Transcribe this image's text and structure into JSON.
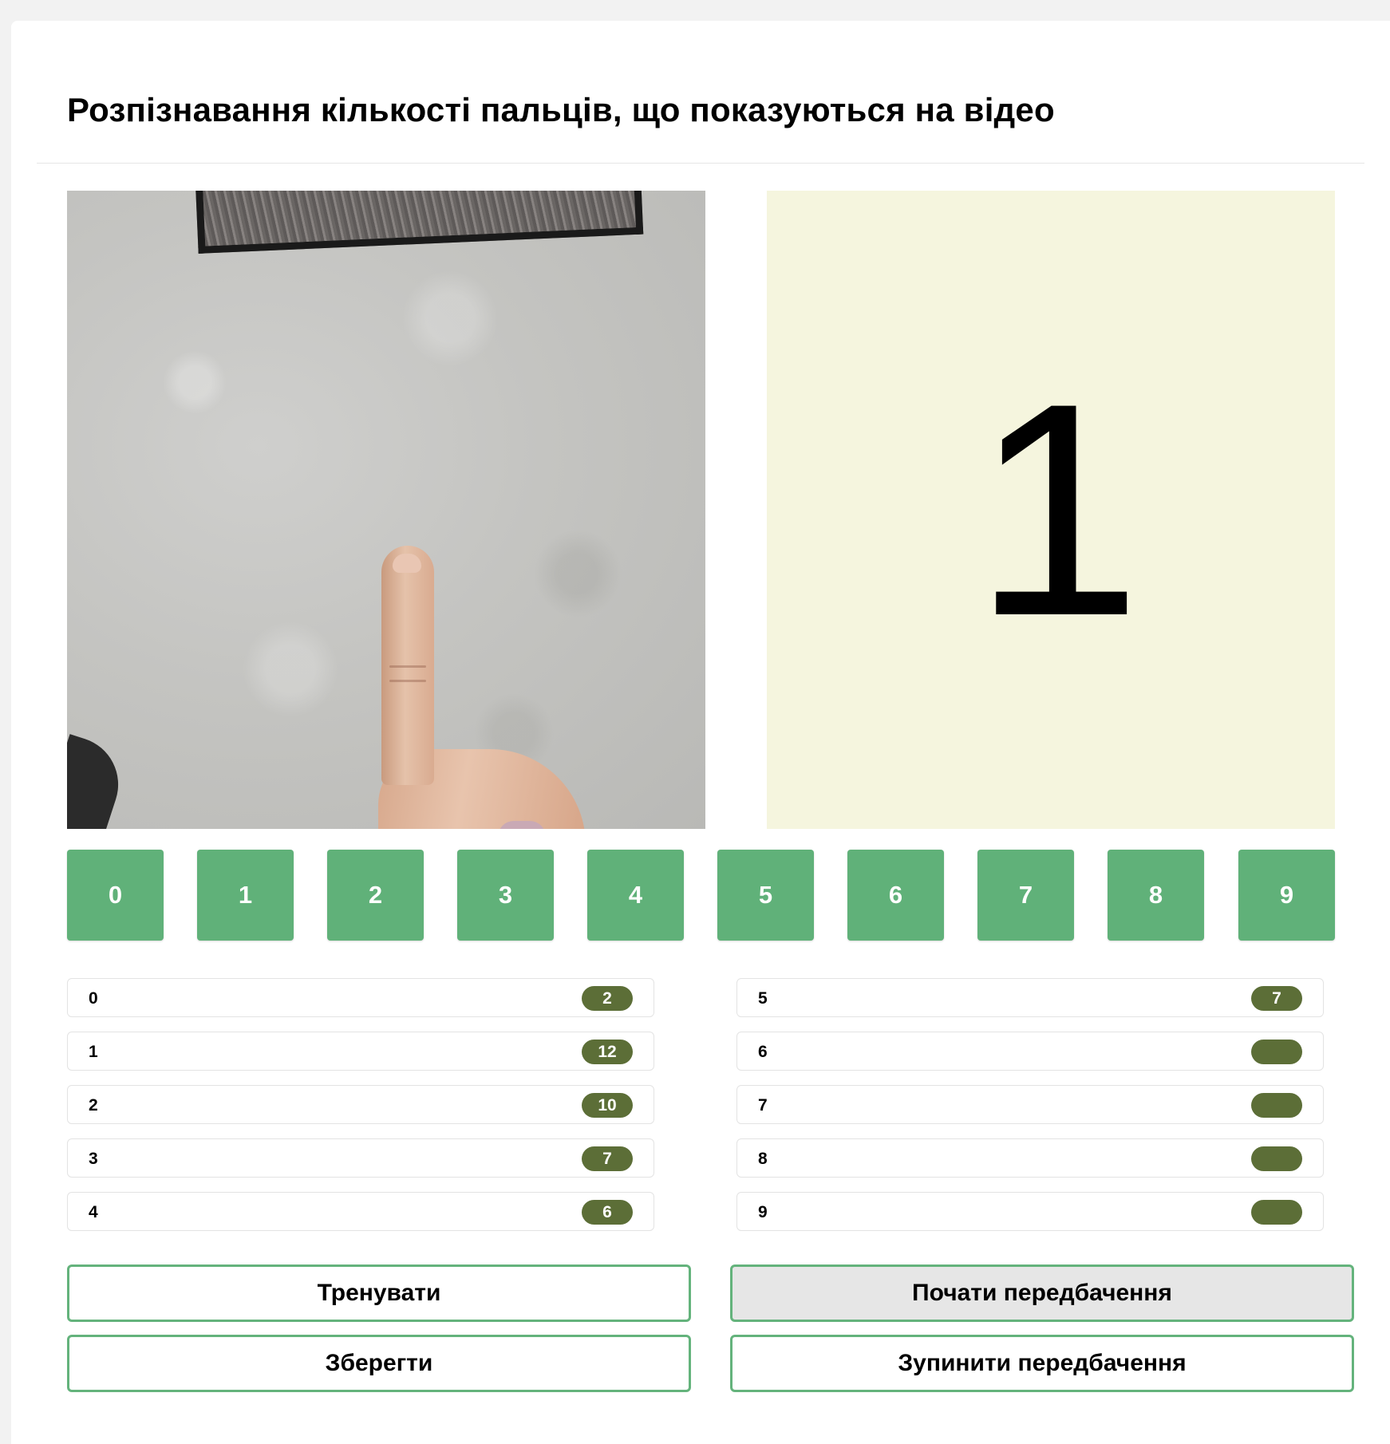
{
  "page": {
    "title": "Розпізнавання кількості пальців, що показуються на відео"
  },
  "prediction": {
    "value": "1"
  },
  "label_buttons": [
    "0",
    "1",
    "2",
    "3",
    "4",
    "5",
    "6",
    "7",
    "8",
    "9"
  ],
  "counts_left": [
    {
      "label": "0",
      "count": "2"
    },
    {
      "label": "1",
      "count": "12"
    },
    {
      "label": "2",
      "count": "10"
    },
    {
      "label": "3",
      "count": "7"
    },
    {
      "label": "4",
      "count": "6"
    }
  ],
  "counts_right": [
    {
      "label": "5",
      "count": "7"
    },
    {
      "label": "6",
      "count": ""
    },
    {
      "label": "7",
      "count": ""
    },
    {
      "label": "8",
      "count": ""
    },
    {
      "label": "9",
      "count": ""
    }
  ],
  "actions": {
    "train": "Тренувати",
    "save": "Зберегти",
    "start_prediction": "Почати передбачення",
    "stop_prediction": "Зупинити передбачення"
  },
  "colors": {
    "label_button": "#60b179",
    "badge": "#5c6e37",
    "action_border": "#64b37c",
    "prediction_bg": "#f5f5de"
  }
}
